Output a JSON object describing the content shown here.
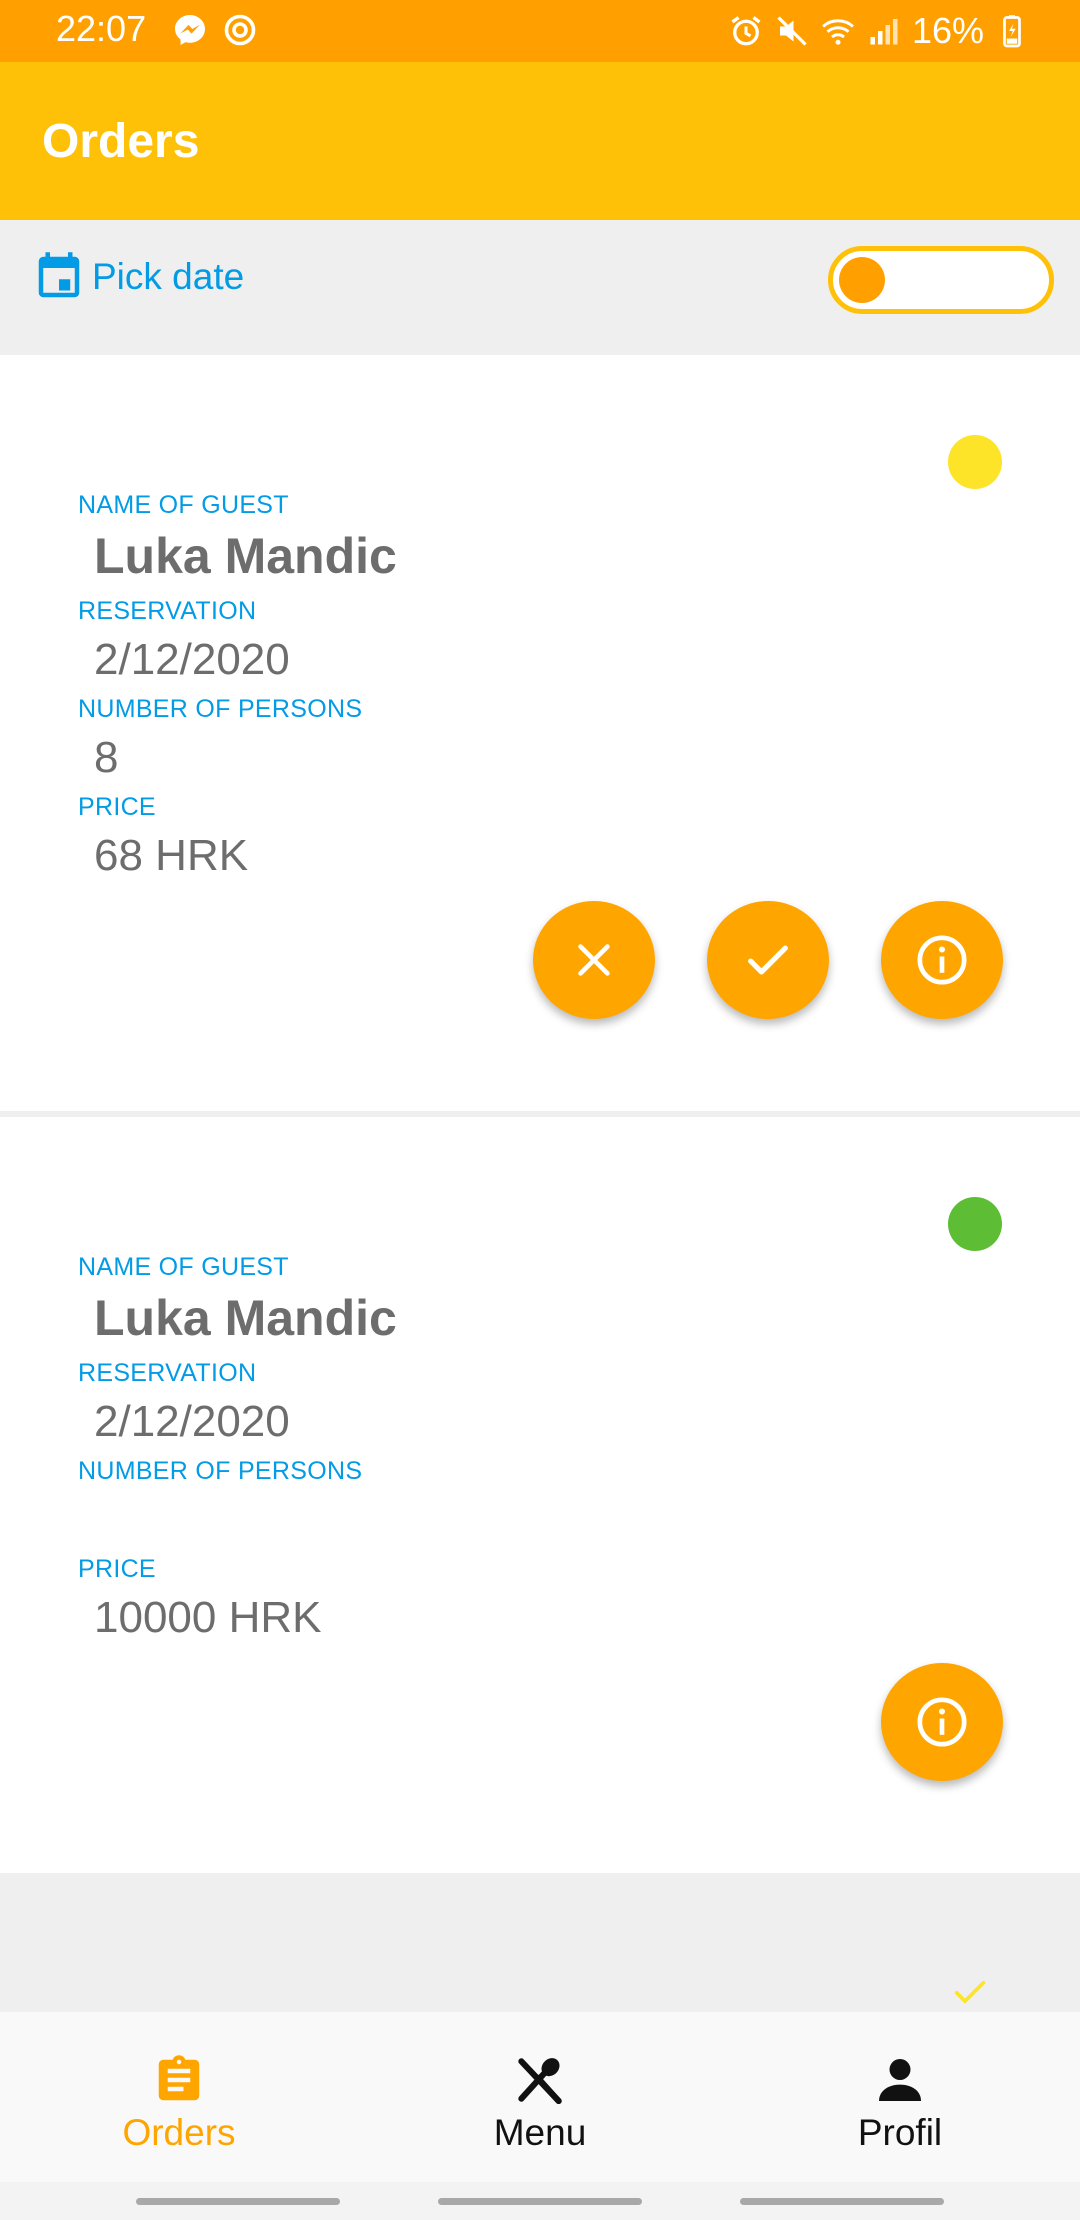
{
  "status_bar": {
    "time": "22:07",
    "battery": "16%",
    "left_icons": [
      "messenger-icon",
      "sync-icon"
    ],
    "right_icons": [
      "alarm-icon",
      "mute-icon",
      "wifi-icon",
      "signal-icon",
      "battery-charging-icon"
    ]
  },
  "app_bar": {
    "title": "Orders",
    "color": "#FFC107"
  },
  "filter": {
    "pick_date_label": "Pick date",
    "toggle_on": false
  },
  "orders": [
    {
      "status_color": "#FDE428",
      "name_label": "NAME OF GUEST",
      "name": "Luka Mandic",
      "reservation_label": "RESERVATION",
      "reservation": "2/12/2020",
      "persons_label": "NUMBER OF PERSONS",
      "persons": "8",
      "price_label": "PRICE",
      "price": "68 HRK",
      "actions": [
        "close-icon",
        "check-icon",
        "info-icon"
      ]
    },
    {
      "status_color": "#5DBE35",
      "name_label": "NAME OF GUEST",
      "name": "Luka Mandic",
      "reservation_label": "RESERVATION",
      "reservation": "2/12/2020",
      "persons_label": "NUMBER OF PERSONS",
      "persons": "",
      "price_label": "PRICE",
      "price": "10000 HRK",
      "actions": [
        "info-icon"
      ]
    }
  ],
  "bottom_nav": {
    "active": "orders",
    "active_color": "#FFA500",
    "items": [
      {
        "label": "Orders",
        "icon": "clipboard-icon"
      },
      {
        "label": "Menu",
        "icon": "utensils-icon"
      },
      {
        "label": "Profil",
        "icon": "person-icon"
      }
    ]
  }
}
